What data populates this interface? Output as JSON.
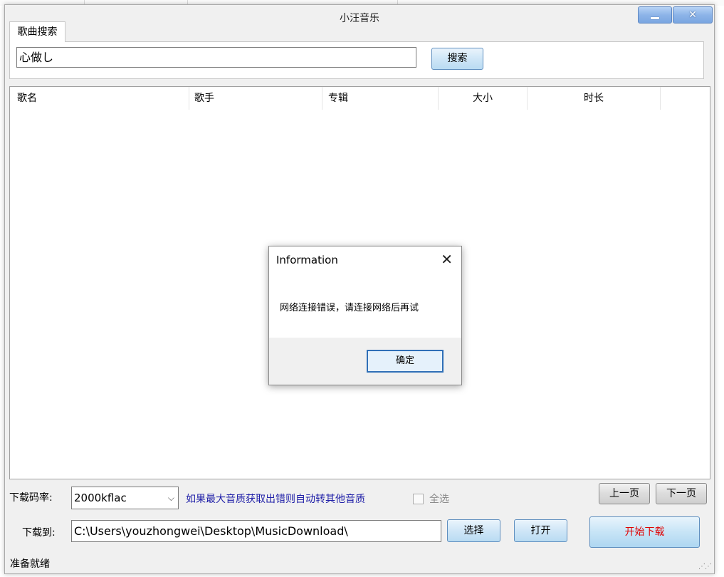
{
  "window": {
    "title": "小汪音乐",
    "min_icon": "minimize-icon",
    "close_icon": "close-icon",
    "close_glyph": "✕"
  },
  "tabs": [
    {
      "label": "歌曲搜索"
    }
  ],
  "search": {
    "value": "心做し",
    "button_label": "搜索"
  },
  "table": {
    "columns": [
      "歌名",
      "歌手",
      "专辑",
      "大小",
      "时长"
    ],
    "rows": []
  },
  "download": {
    "rate_label": "下载码率:",
    "rate_value": "2000kflac",
    "hint": "如果最大音质获取出错则自动转其他音质",
    "select_all_label": "全选",
    "prev_page": "上一页",
    "next_page": "下一页",
    "path_label": "下载到:",
    "path_value": "C:\\Users\\youzhongwei\\Desktop\\MusicDownload\\",
    "choose_label": "选择",
    "open_label": "打开",
    "start_label": "开始下载"
  },
  "status": {
    "text": "准备就绪"
  },
  "dialog": {
    "title": "Information",
    "message": "网络连接错误，请连接网络后再试",
    "ok_label": "确定",
    "close_glyph": "✕"
  },
  "colors": {
    "hint": "#1f1fa8",
    "start_button_text": "#e00000",
    "titlebar_button": "#8db4e8"
  }
}
